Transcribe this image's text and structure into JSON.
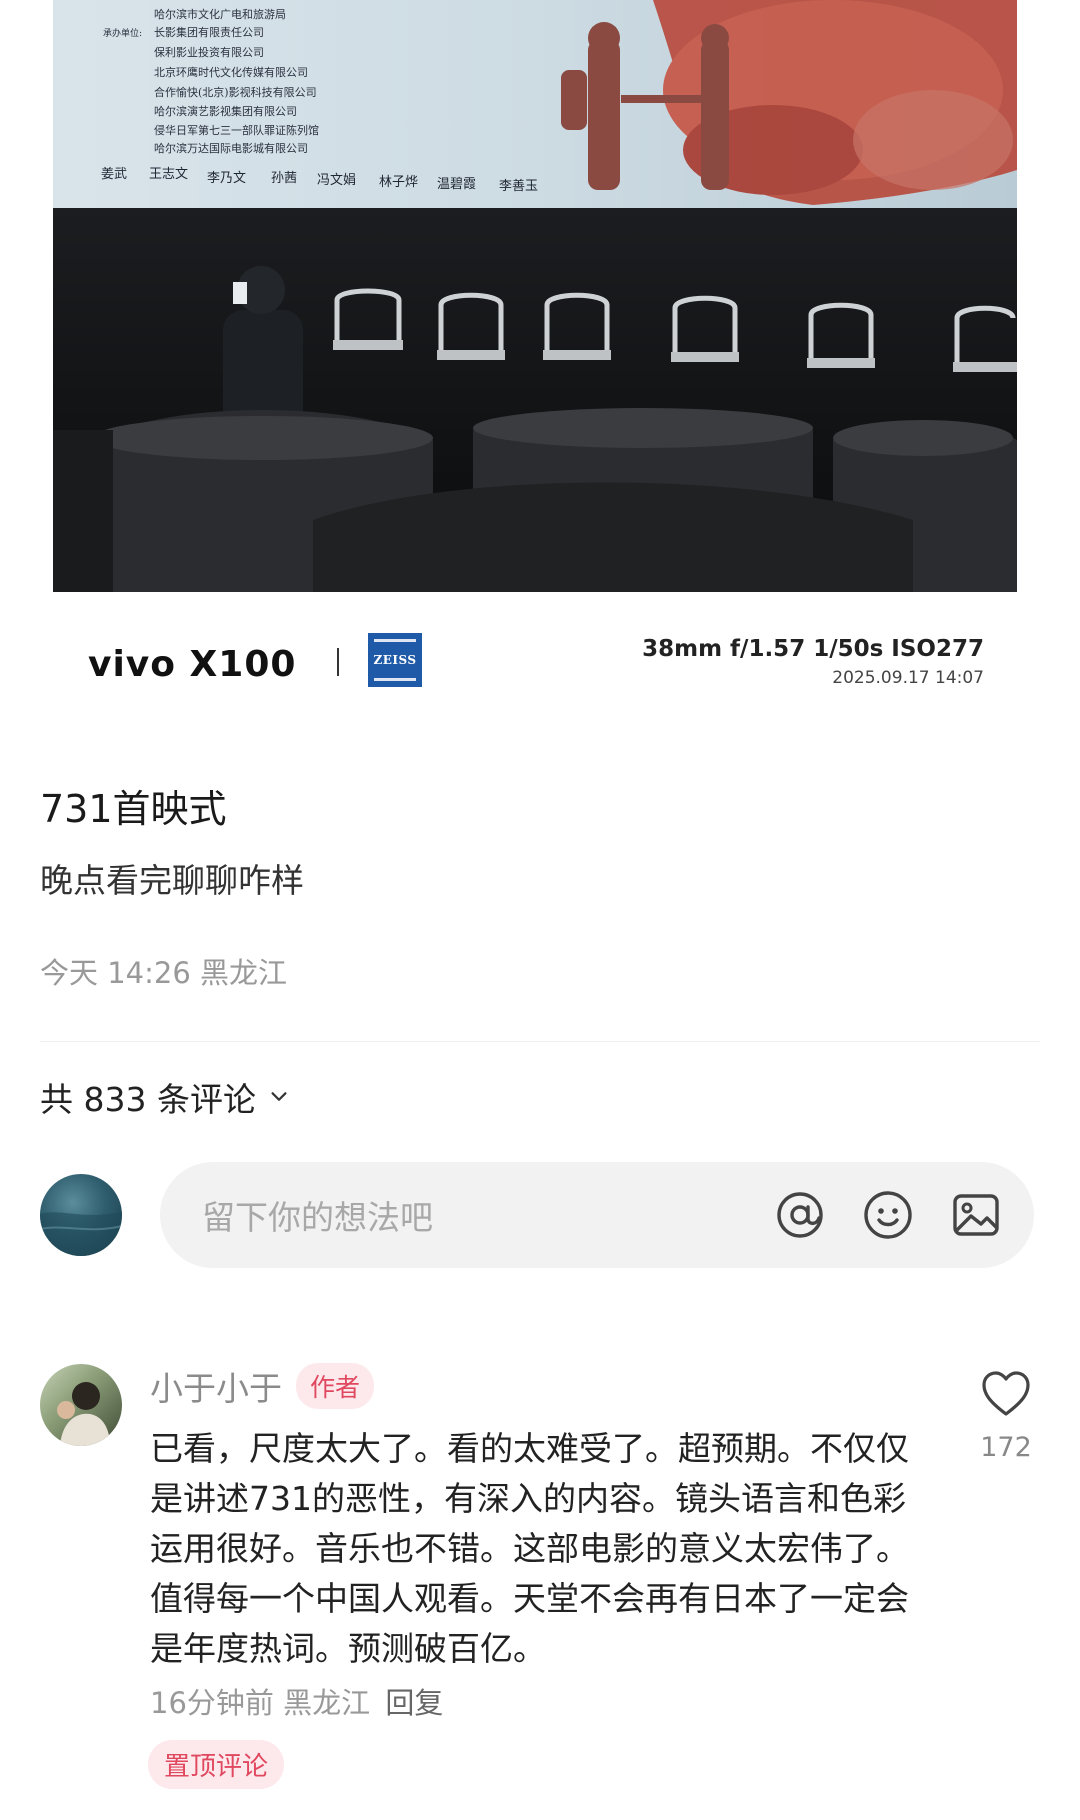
{
  "photo": {
    "credits": [
      "哈尔滨市文化广电和旅游局",
      "长影集团有限责任公司",
      "保利影业投资有限公司",
      "北京环鹰时代文化传媒有限公司",
      "合作愉快(北京)影视科技有限公司",
      "哈尔滨演艺影视集团有限公司",
      "侵华日军第七三一部队罪证陈列馆",
      "哈尔滨万达国际电影城有限公司"
    ],
    "credit_prefix": "承办单位:",
    "cast": [
      "姜武",
      "王志文",
      "李乃文",
      "孙茜",
      "冯文娟",
      "林子烨",
      "温碧霞",
      "李善玉"
    ]
  },
  "watermark": {
    "brand": "vivo X100",
    "lens_brand": "ZEISS",
    "specs": "38mm  f/1.57  1/50s  ISO277",
    "datetime": "2025.09.17 14:07"
  },
  "post": {
    "title": "731首映式",
    "subtitle": "晚点看完聊聊咋样",
    "meta": "今天 14:26 黑龙江"
  },
  "comments_header": {
    "label": "共 833 条评论"
  },
  "input": {
    "placeholder": "留下你的想法吧",
    "icons": [
      "at-icon",
      "emoji-icon",
      "image-icon"
    ]
  },
  "comment": {
    "user": "小于小于",
    "badge": "作者",
    "text": "已看，尺度太大了。看的太难受了。超预期。不仅仅是讲述731的恶性，有深入的内容。镜头语言和色彩运用很好。音乐也不错。这部电影的意义太宏伟了。值得每一个中国人观看。天堂不会再有日本了一定会是年度热词。预测破百亿。",
    "time_location": "16分钟前 黑龙江",
    "reply": "回复",
    "pinned": "置顶评论",
    "likes": "172"
  },
  "colors": {
    "accent": "#e0485f",
    "accent_bg": "#fde9ec",
    "muted": "#999999"
  }
}
